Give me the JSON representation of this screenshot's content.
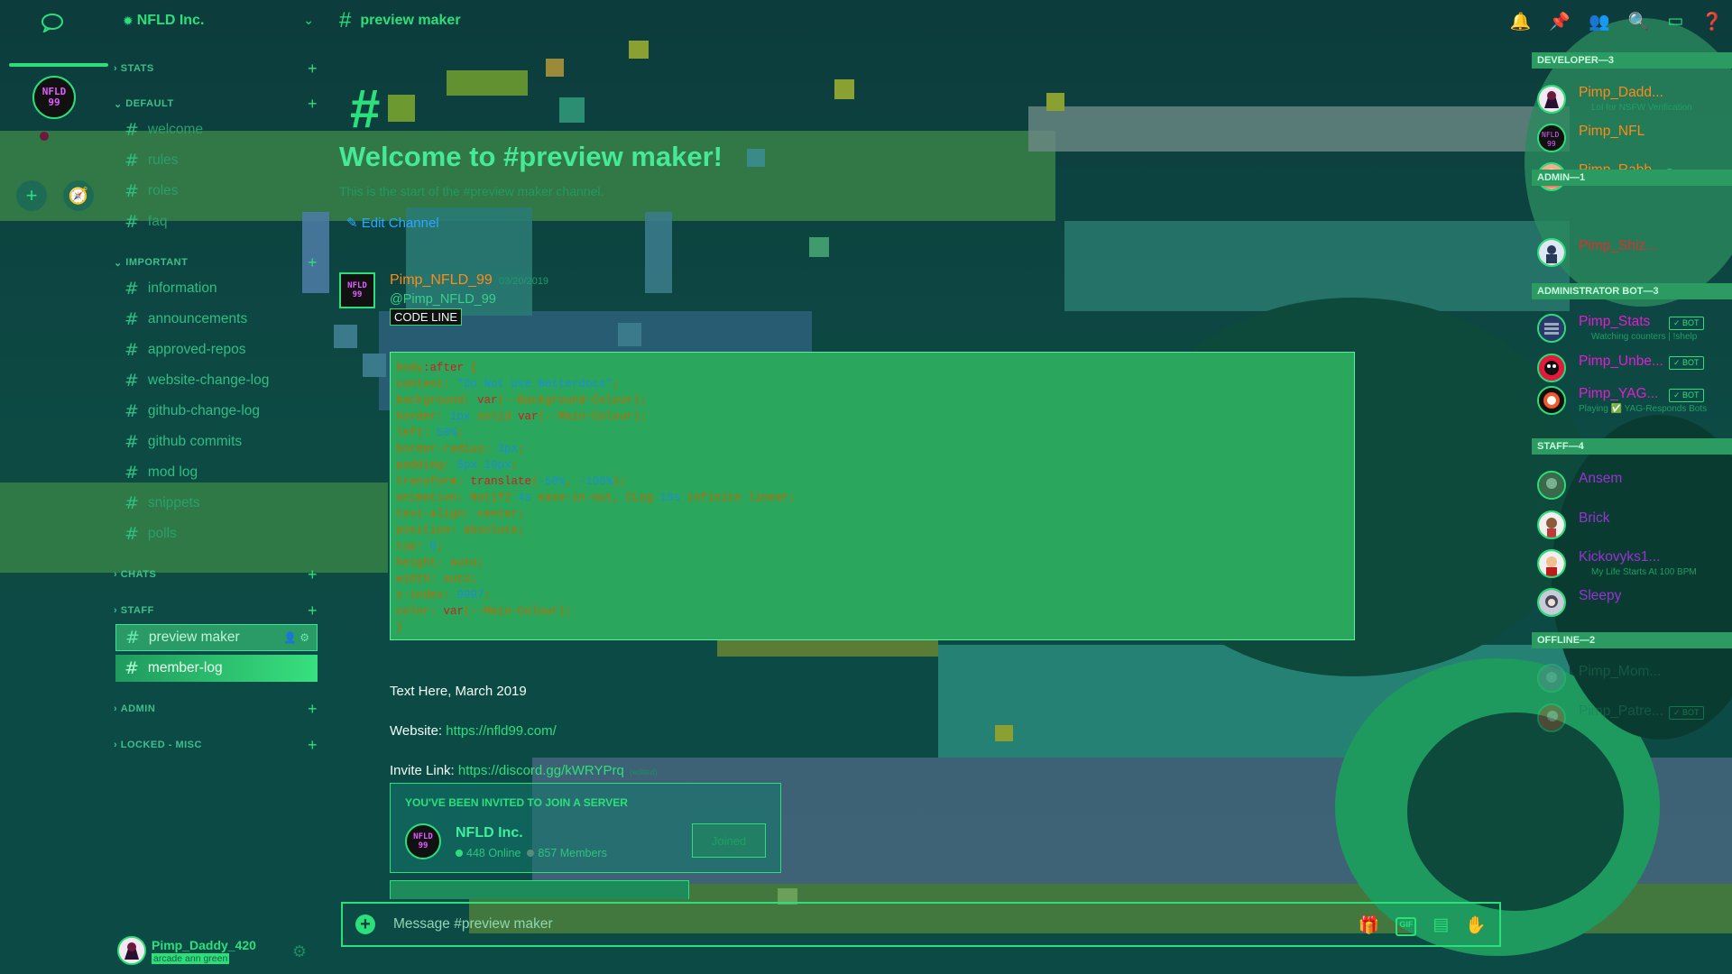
{
  "server": {
    "name": "NFLD Inc.",
    "logo_text": "NFLD 99"
  },
  "sidebar": {
    "categories": {
      "stats": "STATS",
      "default": "DEFAULT",
      "important": "IMPORTANT",
      "chats": "CHATS",
      "staff": "STAFF",
      "admin": "ADMIN",
      "locked": "LOCKED - MISC"
    },
    "channels": {
      "welcome": "welcome",
      "rules": "rules",
      "roles": "roles",
      "faq": "faq",
      "information": "information",
      "announcements": "announcements",
      "approved_repos": "approved-repos",
      "website_change_log": "website-change-log",
      "github_change_log": "github-change-log",
      "github_commits": "github commits",
      "mod_log": "mod log",
      "snippets": "snippets",
      "polls": "polls",
      "preview_maker": "preview maker",
      "member_log": "member-log"
    }
  },
  "user": {
    "name": "Pimp_Daddy_420",
    "status": "arcade ann green"
  },
  "header": {
    "channel": "preview maker"
  },
  "main": {
    "welcome_title": "Welcome to #preview maker!",
    "welcome_sub": "This is the start of the #preview maker channel.",
    "edit_channel": "Edit Channel",
    "message": {
      "author": "Pimp_NFLD_99",
      "timestamp": "03/20/2019",
      "mention": "@Pimp_NFLD_99",
      "code_label": "CODE LINE"
    },
    "code_lines": [
      [
        [
          "p",
          "body"
        ],
        [
          "f",
          ":after"
        ],
        [
          "p",
          " {"
        ]
      ],
      [
        [
          "p",
          "content: "
        ],
        [
          "s",
          "\"Do Not Use Betterdocs\""
        ],
        [
          "p",
          ";"
        ]
      ],
      [
        [
          "p",
          "background: "
        ],
        [
          "f",
          "var"
        ],
        [
          "p",
          "(--Background-Colour);"
        ]
      ],
      [
        [
          "p",
          "border: "
        ],
        [
          "v",
          "1px"
        ],
        [
          "p",
          " solid "
        ],
        [
          "f",
          "var"
        ],
        [
          "p",
          "(--Main-Colour);"
        ]
      ],
      [
        [
          "p",
          "left: "
        ],
        [
          "v",
          "50%"
        ],
        [
          "p",
          ";"
        ]
      ],
      [
        [
          "p",
          "border-radius: "
        ],
        [
          "v",
          "3px"
        ],
        [
          "p",
          ";"
        ]
      ],
      [
        [
          "p",
          "padding: "
        ],
        [
          "v",
          "5px 10px"
        ],
        [
          "p",
          ";"
        ]
      ],
      [
        [
          "p",
          "transform: "
        ],
        [
          "f",
          "translate"
        ],
        [
          "p",
          "("
        ],
        [
          "v",
          "-50%"
        ],
        [
          "p",
          ", "
        ],
        [
          "v",
          "-100%"
        ],
        [
          "p",
          ");"
        ]
      ],
      [
        [
          "p",
          "animation: Notif2 "
        ],
        [
          "v",
          "4s"
        ],
        [
          "p",
          " ease-in-out, CLog "
        ],
        [
          "v",
          "10s"
        ],
        [
          "p",
          " infinite linear;"
        ]
      ],
      [
        [
          "p",
          "text-align: center;"
        ]
      ],
      [
        [
          "p",
          "position: absolute;"
        ]
      ],
      [
        [
          "p",
          "top: "
        ],
        [
          "v",
          "0"
        ],
        [
          "p",
          ";"
        ]
      ],
      [
        [
          "p",
          "height: auto;"
        ]
      ],
      [
        [
          "p",
          "width: auto;"
        ]
      ],
      [
        [
          "p",
          "z-index: "
        ],
        [
          "v",
          "9997"
        ],
        [
          "p",
          ";"
        ]
      ],
      [
        [
          "p",
          "color: "
        ],
        [
          "f",
          "var"
        ],
        [
          "p",
          "(--Main-Colour);"
        ]
      ],
      [
        [
          "p",
          "}"
        ]
      ]
    ],
    "text_here": "Text Here, March 2019",
    "website_label": "Website: ",
    "website_url": "https://nfld99.com/",
    "invite_label": "Invite Link: ",
    "invite_url": "https://discord.gg/kWRYPrq",
    "edited": "(edited)",
    "invite_card": {
      "header": "YOU'VE BEEN INVITED TO JOIN A SERVER",
      "server_name": "NFLD Inc.",
      "online": "448 Online",
      "members": "857 Members",
      "button": "Joined"
    }
  },
  "composer": {
    "placeholder": "Message #preview maker",
    "gif": "GIF"
  },
  "members": {
    "groups": {
      "developer": "DEVELOPER—3",
      "admin": "ADMIN—1",
      "admin_bot": "ADMINISTRATOR BOT—3",
      "staff": "STAFF—4",
      "offline": "OFFLINE—2"
    },
    "list": {
      "m1": {
        "name": "Pimp_Dadd...",
        "sub": "Lol for NSFW Verification"
      },
      "m2": {
        "name": "Pimp_NFL"
      },
      "m3": {
        "name": "Pimp_Rabb..."
      },
      "m4": {
        "name": "Pimp_Shiz..."
      },
      "m5": {
        "name": "Pimp_Stats",
        "sub": "Watching counters | !shelp",
        "badge": "✓ BOT"
      },
      "m6": {
        "name": "Pimp_Unbe...",
        "badge": "✓ BOT"
      },
      "m7": {
        "name": "Pimp_YAG...",
        "sub": "Playing ✅ YAG-Responds Bots",
        "badge": "✓ BOT"
      },
      "m8": {
        "name": "Ansem"
      },
      "m9": {
        "name": "Brick"
      },
      "m10": {
        "name": "Kickovyks1...",
        "sub": "My Life Starts At 100 BPM"
      },
      "m11": {
        "name": "Sleepy"
      },
      "m12": {
        "name": "Pimp_Mom..."
      },
      "m13": {
        "name": "Pimp_Patre...",
        "badge": "✓ BOT"
      }
    }
  },
  "colors": {
    "accent": "#2be07a",
    "background": "#0b3a3f",
    "developer_role": "#ff8a16",
    "admin_role": "#e52b2b",
    "bot_role": "#e41cd4",
    "staff_role": "#9a32d8"
  }
}
